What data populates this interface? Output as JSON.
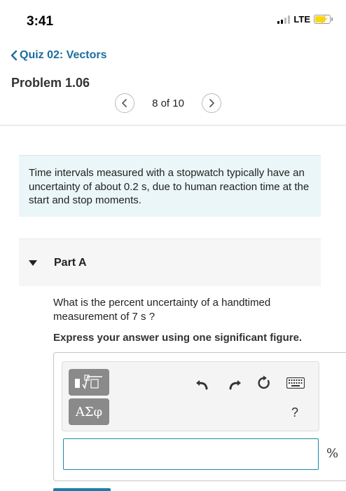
{
  "status_bar": {
    "time": "3:41",
    "network": "LTE"
  },
  "nav": {
    "back_label": "Quiz 02: Vectors",
    "problem_title": "Problem 1.06",
    "pager_text": "8 of 10"
  },
  "problem": {
    "intro": "Time intervals measured with a stopwatch typically have an uncertainty of about 0.2 s, due to human reaction time at the start and stop moments."
  },
  "part": {
    "label": "Part A",
    "question": "What is the percent uncertainty of a handtimed measurement of 7 s ?",
    "instruction": "Express your answer using one significant figure.",
    "symbols_label": "ΑΣφ",
    "help_label": "?",
    "answer_value": "",
    "unit": "%"
  },
  "icons": {
    "back": "chevron-left-icon",
    "prev": "chevron-left-icon",
    "next": "chevron-right-icon",
    "collapse": "caret-down-icon",
    "templates": "math-templates-icon",
    "undo": "undo-icon",
    "redo": "redo-icon",
    "reset": "reset-icon",
    "keyboard": "keyboard-icon"
  },
  "colors": {
    "link": "#1a6e9e",
    "info_background": "#eaf6f7",
    "input_border": "#1e8ba5",
    "tool_button": "#8a8a8a"
  }
}
